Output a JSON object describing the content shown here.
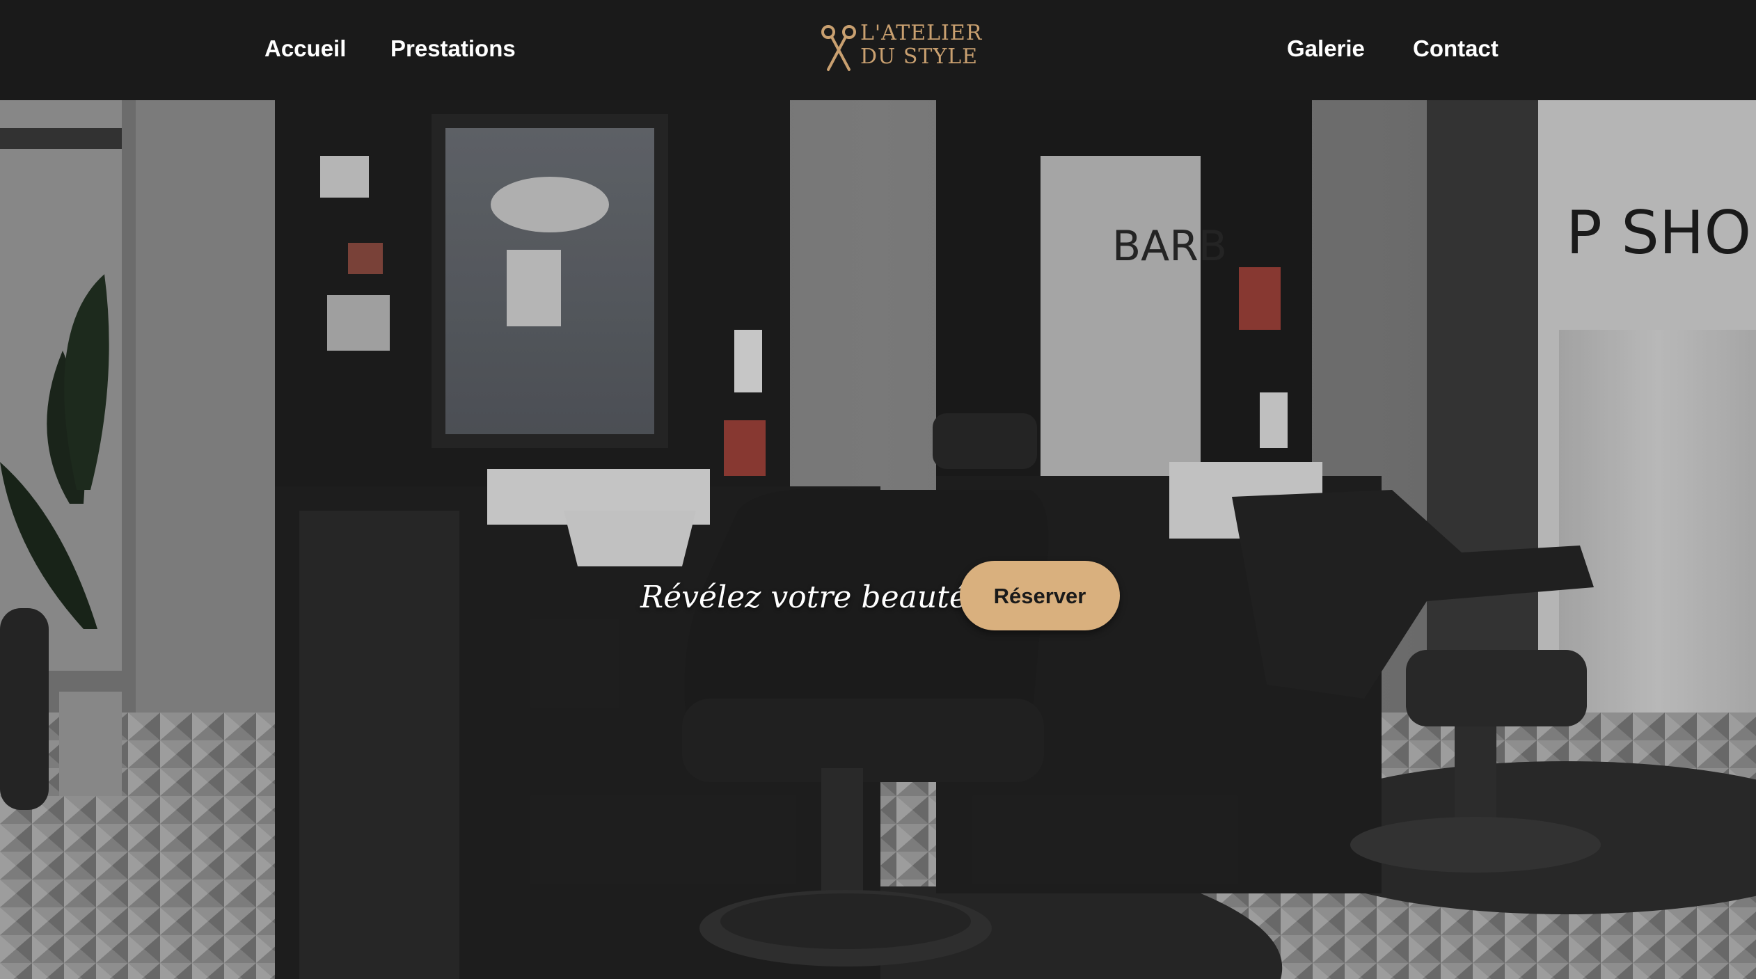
{
  "nav": {
    "left": [
      "Accueil",
      "Prestations"
    ],
    "right": [
      "Galerie",
      "Contact"
    ]
  },
  "logo": {
    "line1": "L'ATELIER",
    "line2": "DU STYLE",
    "icon": "scissors-icon"
  },
  "hero": {
    "tagline": "Révélez votre beauté",
    "cta_label": "Réserver",
    "background_alt": "barbershop-interior-photo"
  },
  "colors": {
    "nav_bg": "#1a1a1a",
    "accent": "#d9b07e",
    "logo_gold": "#c9a070",
    "nav_text": "#ffffff"
  }
}
